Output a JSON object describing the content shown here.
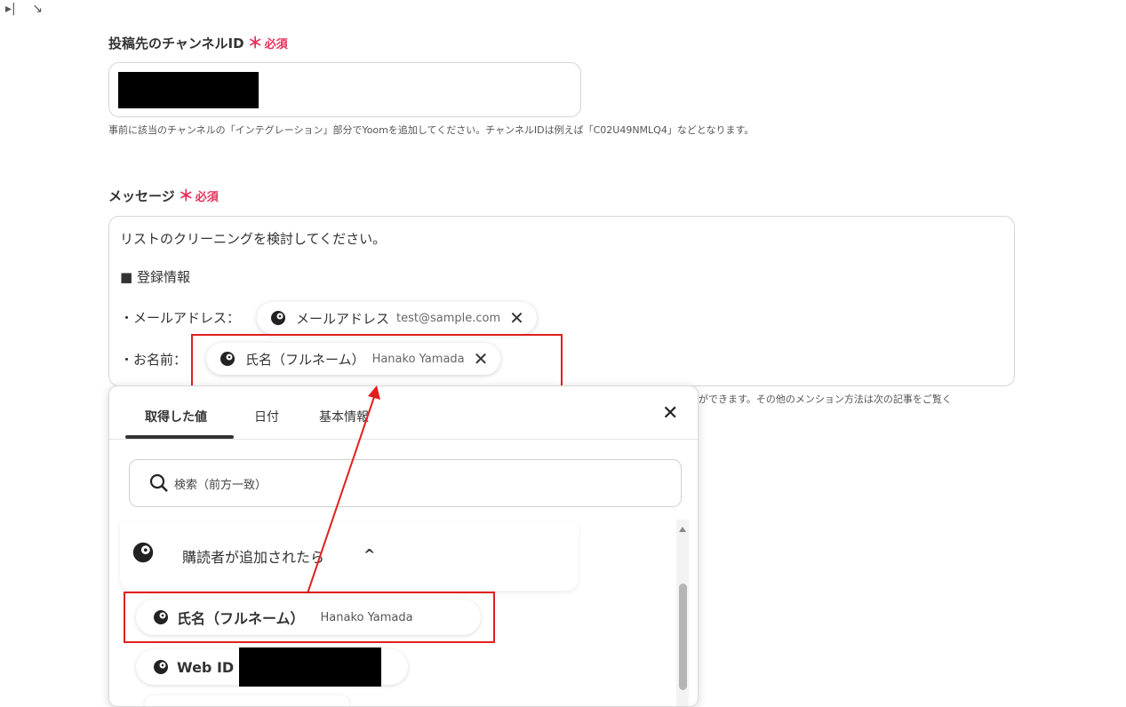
{
  "toolbar": {
    "icon1": "▸|",
    "icon2": "↘"
  },
  "channel": {
    "label": "投稿先のチャンネルID",
    "required_star": "＊",
    "required_text": "必須",
    "help": "事前に該当のチャンネルの「インテグレーション」部分でYoomを追加してください。チャンネルIDは例えば「C02U49NMLQ4」などとなります。"
  },
  "message": {
    "label": "メッセージ",
    "required_star": "＊",
    "required_text": "必須",
    "line1": "リストのクリーニングを検討してください。",
    "line2": "■ 登録情報",
    "email_prefix": "・メールアドレス：",
    "name_prefix": "・お名前：",
    "email_chip": {
      "label": "メールアドレス",
      "value": "test@sample.com",
      "close": "✕"
    },
    "name_chip": {
      "label": "氏名（フルネーム）",
      "value": "Hanako Yamada",
      "close": "✕"
    },
    "help_partial": "ができます。その他のメンション方法は次の記事をご覧く"
  },
  "picker": {
    "tabs": [
      "取得した値",
      "日付",
      "基本情報"
    ],
    "close": "✕",
    "search_placeholder": "検索（前方一致）",
    "section_title": "購読者が追加されたら",
    "section_chevron": "^",
    "items": [
      {
        "label": "氏名（フルネーム）",
        "value": "Hanako Yamada"
      },
      {
        "label": "Web ID",
        "value": ""
      }
    ]
  },
  "colors": {
    "required": "#e8315b",
    "highlight": "#e0201e",
    "text": "#333333"
  }
}
